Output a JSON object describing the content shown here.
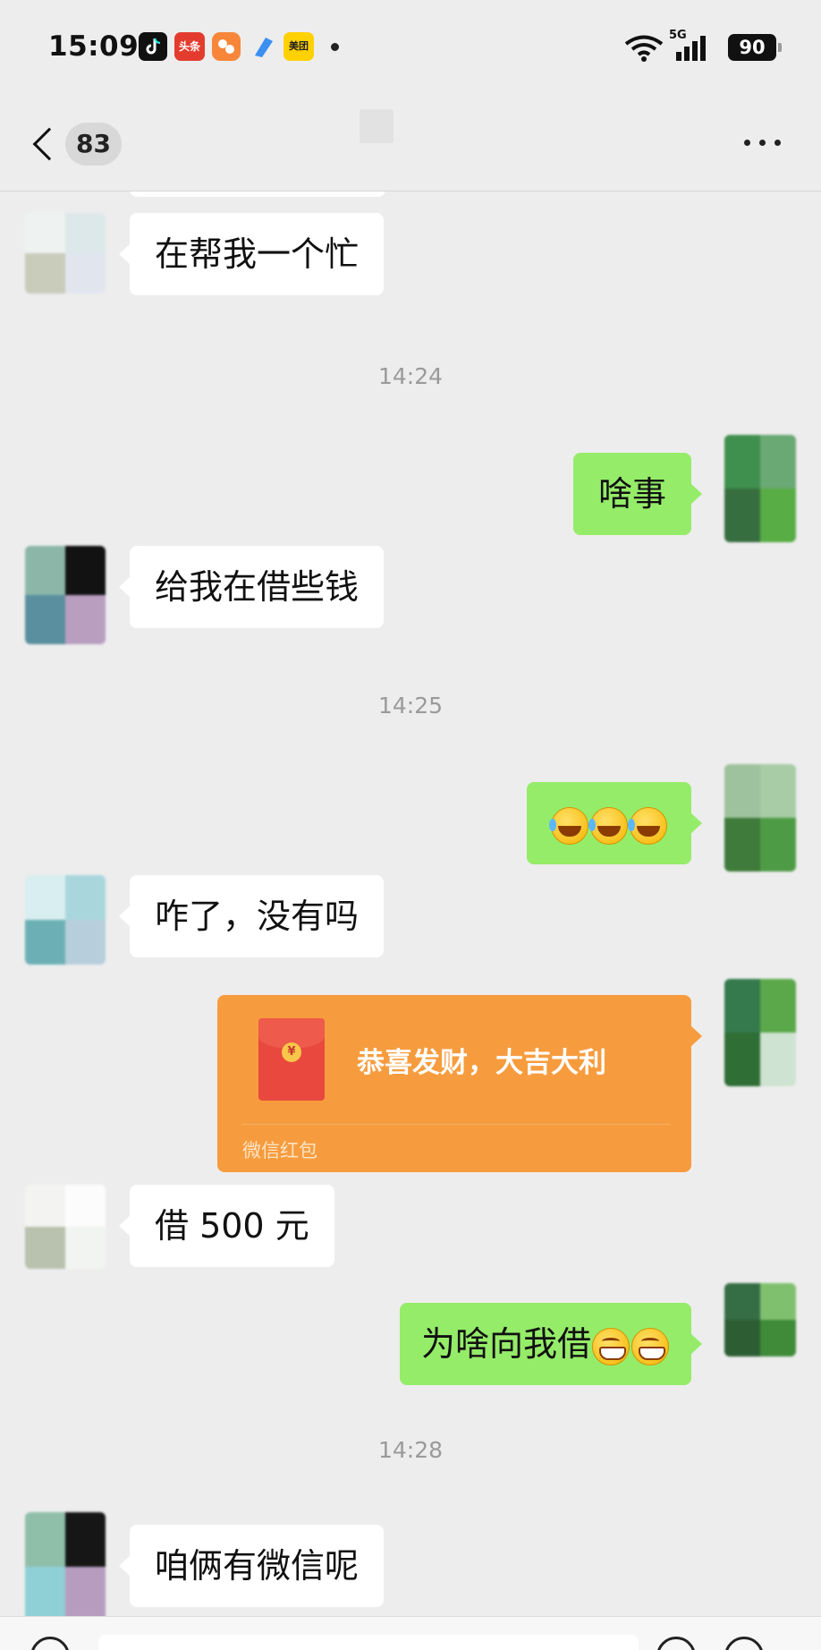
{
  "status_bar": {
    "time": "15:09",
    "apps": [
      {
        "name": "douyin-icon",
        "label": "",
        "color": "#111111"
      },
      {
        "name": "toutiao-icon",
        "label": "头条",
        "color": "#e33c2f"
      },
      {
        "name": "app-orange-icon",
        "label": "",
        "color": "#f7863a"
      },
      {
        "name": "app-blue-icon",
        "label": "",
        "color": "#3b8ff2"
      },
      {
        "name": "meituan-icon",
        "label": "美团",
        "color": "#ffd100"
      }
    ],
    "network": "5G",
    "battery": "90"
  },
  "nav": {
    "unread_count": "83"
  },
  "messages": [
    {
      "kind": "in",
      "text": "在帮我一个忙"
    },
    {
      "kind": "time",
      "text": "14:24"
    },
    {
      "kind": "out",
      "text": "啥事"
    },
    {
      "kind": "in",
      "text": "给我在借些钱"
    },
    {
      "kind": "time",
      "text": "14:25"
    },
    {
      "kind": "out",
      "emoji": [
        "laughing-crying-emoji",
        "laughing-crying-emoji",
        "laughing-crying-emoji"
      ]
    },
    {
      "kind": "in",
      "text": "咋了，没有吗"
    },
    {
      "kind": "out",
      "red_packet": {
        "title": "恭喜发财，大吉大利",
        "footer": "微信红包"
      }
    },
    {
      "kind": "in",
      "text": "借 500 元"
    },
    {
      "kind": "out",
      "text": "为啥向我借",
      "emoji": [
        "grinning-emoji",
        "grinning-emoji"
      ]
    },
    {
      "kind": "time",
      "text": "14:28"
    },
    {
      "kind": "in",
      "text": "咱俩有微信呢"
    }
  ],
  "colors": {
    "background": "#ededed",
    "incoming_bubble": "#ffffff",
    "outgoing_bubble": "#95ec69",
    "red_packet": "#f79c3e",
    "timestamp": "#9a9a9a"
  }
}
